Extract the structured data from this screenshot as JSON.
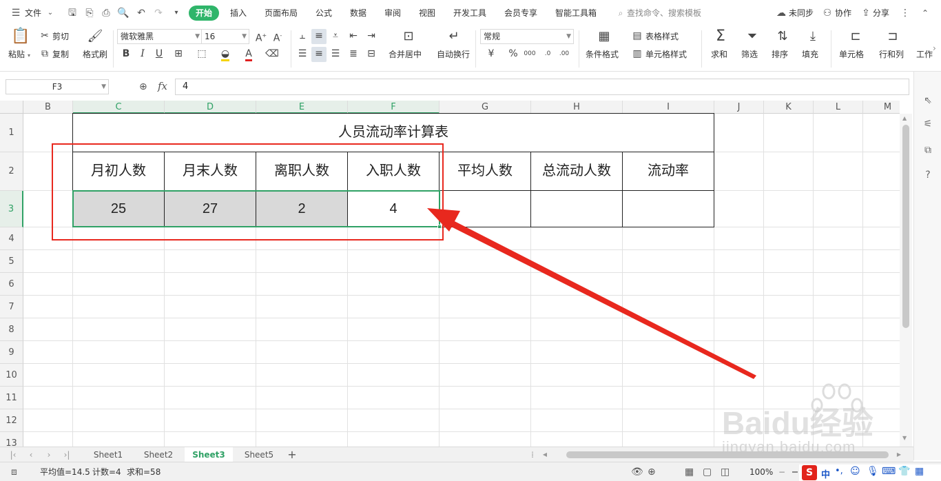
{
  "menu": {
    "file_label": "文件",
    "tabs": [
      "开始",
      "插入",
      "页面布局",
      "公式",
      "数据",
      "审阅",
      "视图",
      "开发工具",
      "会员专享",
      "智能工具箱"
    ],
    "active_tab": "开始",
    "search_placeholder": "查找命令、搜索模板",
    "unsync_label": "未同步",
    "collab_label": "协作",
    "share_label": "分享"
  },
  "ribbon": {
    "paste": "粘贴",
    "cut": "剪切",
    "copy": "复制",
    "format_painter": "格式刷",
    "font_name": "微软雅黑",
    "font_size": "16",
    "merge_center": "合并居中",
    "wrap_text": "自动换行",
    "number_format": "常规",
    "conditional_format": "条件格式",
    "table_style": "表格样式",
    "cell_style": "单元格样式",
    "sum": "求和",
    "filter": "筛选",
    "sort": "排序",
    "fill": "填充",
    "cell": "单元格",
    "row_col": "行和列",
    "worksheet": "工作"
  },
  "formula_bar": {
    "name_box": "F3",
    "fx": "fx",
    "formula": "4"
  },
  "columns": [
    "B",
    "C",
    "D",
    "E",
    "F",
    "G",
    "H",
    "I",
    "J",
    "K",
    "L",
    "M"
  ],
  "rows": [
    "1",
    "2",
    "3",
    "4",
    "5",
    "6",
    "7",
    "8",
    "9",
    "10",
    "11",
    "12",
    "13"
  ],
  "table": {
    "title": "人员流动率计算表",
    "headers": [
      "月初人数",
      "月末人数",
      "离职人数",
      "入职人数",
      "平均人数",
      "总流动人数",
      "流动率"
    ],
    "values": [
      "25",
      "27",
      "2",
      "4",
      "",
      "",
      ""
    ]
  },
  "sheets": [
    "Sheet1",
    "Sheet2",
    "Sheet3",
    "Sheet5"
  ],
  "active_sheet": "Sheet3",
  "status": {
    "average": "平均值=14.5",
    "count": "计数=4",
    "sum": "求和=58",
    "zoom": "100%"
  },
  "ime": {
    "lang": "中"
  },
  "watermark": {
    "line1": "Baidu经验",
    "line2": "jingyan.baidu.com"
  },
  "colors": {
    "accent": "#2fb56a",
    "selection": "#2fa165",
    "annotation": "#e8281e",
    "gray_fill": "#d9d9d9"
  }
}
